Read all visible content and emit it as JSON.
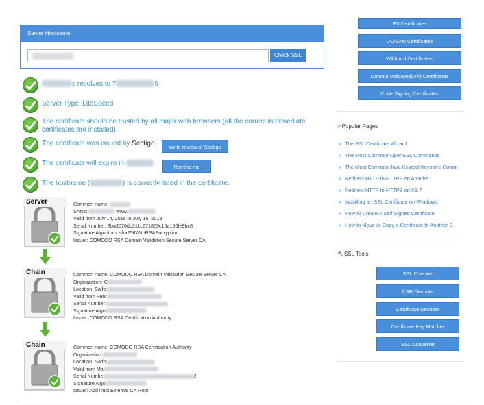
{
  "hostname_panel": {
    "title": "Server Hostname",
    "check_label": "Check SSL"
  },
  "results": {
    "resolves": {
      "text": "s resolves to 7",
      "suffix": "9"
    },
    "server_type": "Server Type: LiteSpeed",
    "trusted": "The certificate should be trusted by all major web browsers (all the correct intermediate certificates are installed).",
    "issued_prefix": "The certificate was issued by ",
    "issued_by": "Sectigo",
    "issued_suffix": ".",
    "review_label": "Write review of Sectigo",
    "expire_prefix": "The certificate will expire in",
    "remind_label": "Remind me",
    "hostname_prefix": "The hostname (",
    "hostname_suffix": ") is correctly listed in the certificate."
  },
  "chain": {
    "server": {
      "badge": "Server",
      "common_name": "Common name:",
      "sans": "SANs:",
      "sans_tail": "www.",
      "valid_key": "Valid",
      "valid_val": " from July 14, 2018 to July 15, 2019",
      "serial_key": "Serial Number:",
      "serial_val": " 8ba3076db311c671859c16a156fe9bc8",
      "sig_key": "Signature Algorithm:",
      "sig_val": " sha256WithRSAEncryption",
      "issuer_key": "Issuer:",
      "issuer_val": " COMODO RSA Domain Validation Secure Server CA"
    },
    "chain1": {
      "badge": "Chain",
      "common_name": "Common name: COMODO RSA Domain Validation Secure Server CA",
      "org": "Organization: C",
      "loc": "Location: Salfo",
      "valid": "Valid from Febr",
      "serial": "Serial Number:",
      "sig": "Signature Algo",
      "issuer": "Issuer: COMODO RSA Certification Authority"
    },
    "chain2": {
      "badge": "Chain",
      "common_name": "Common name: COMODO RSA Certification Authority",
      "org": "Organization:",
      "loc": "Location: Salfo",
      "valid": "Valid from Ma",
      "serial": "Serial Numbe",
      "serial_tail": "2",
      "sig": "Signature Algo",
      "issuer": "Issuer: AddTrust External CA Root"
    }
  },
  "sidebar": {
    "cert_buttons": [
      "EV Certificates",
      "UC/SAN Certificates",
      "Wildcard Certificates",
      "Domain Validated(DV) Certificates",
      "Code Signing Certificates"
    ],
    "popular_title": "Popular Pages",
    "popular_links": [
      "The SSL Certificate Wizard",
      "The Most Common OpenSSL Commands",
      "The Most Common Java Keytool Keystore Comm",
      "Redirect HTTP to HTTPS on Apache",
      "Redirect HTTP to HTTPS on IIS 7",
      "Installing an SSL Certificate on Windows",
      "How to Create A Self Signed Certificate",
      "How to Move or Copy a Certificate to Another S"
    ],
    "tools_title": "SSL Tools",
    "tools": [
      "SSL Checker",
      "CSR Decoder",
      "Certificate Decoder",
      "Certificate Key Matcher",
      "SSL Converter"
    ]
  },
  "colors": {
    "accent": "#4a8fdb",
    "link": "#3a91c1",
    "check": "#4caf2f"
  }
}
